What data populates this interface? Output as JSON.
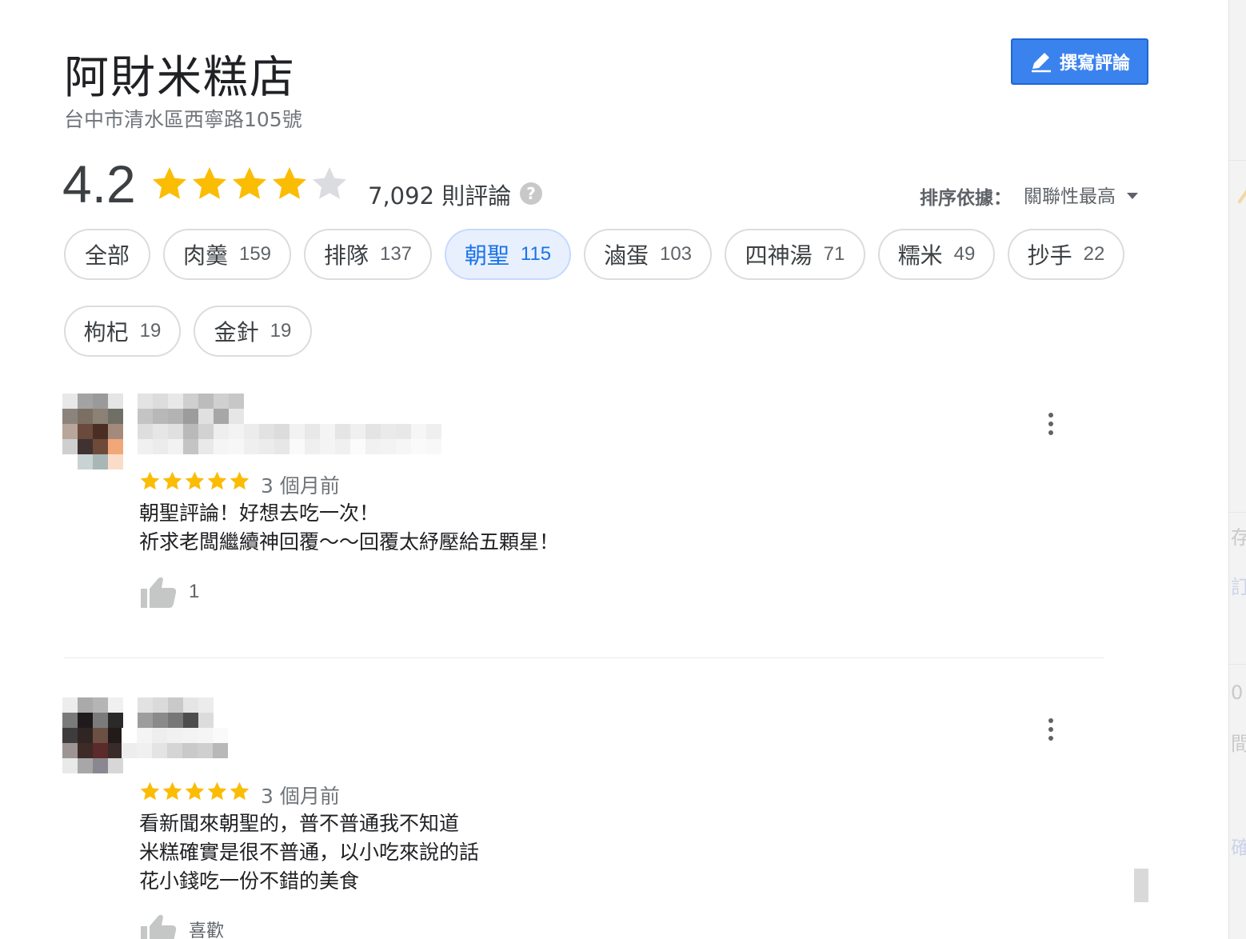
{
  "place": {
    "name": "阿財米糕店",
    "address": "台中市清水區西寧路105號"
  },
  "write_review_label": "撰寫評論",
  "summary": {
    "rating": "4.2",
    "stars_filled": 4,
    "stars_total": 5,
    "review_count": "7,092 則評論",
    "help_icon": "question-mark-icon"
  },
  "sort": {
    "label": "排序依據：",
    "value": "關聯性最高"
  },
  "topics": [
    {
      "label": "全部",
      "count": ""
    },
    {
      "label": "肉羹",
      "count": "159"
    },
    {
      "label": "排隊",
      "count": "137"
    },
    {
      "label": "朝聖",
      "count": "115",
      "selected": true
    },
    {
      "label": "滷蛋",
      "count": "103"
    },
    {
      "label": "四神湯",
      "count": "71"
    },
    {
      "label": "糯米",
      "count": "49"
    },
    {
      "label": "抄手",
      "count": "22"
    },
    {
      "label": "枸杞",
      "count": "19"
    },
    {
      "label": "金針",
      "count": "19"
    }
  ],
  "reviews": [
    {
      "stars": 5,
      "time": "3 個月前",
      "lines": [
        "朝聖評論！好想去吃一次！",
        "祈求老闆繼續神回覆～～回覆太紓壓給五顆星！"
      ],
      "likes": "1"
    },
    {
      "stars": 5,
      "time": "3 個月前",
      "lines": [
        "看新聞來朝聖的，普不普通我不知道",
        "米糕確實是很不普通，以小吃來說的話",
        "花小錢吃一份不錯的美食"
      ],
      "likes": "喜歡"
    }
  ],
  "map_edge": [
    "存",
    "訂",
    "0",
    "間",
    "確"
  ],
  "colors": {
    "star": "#fbbc04",
    "star_empty": "#dadce0",
    "accent": "#1a73e8",
    "button": "#3a82ee"
  }
}
